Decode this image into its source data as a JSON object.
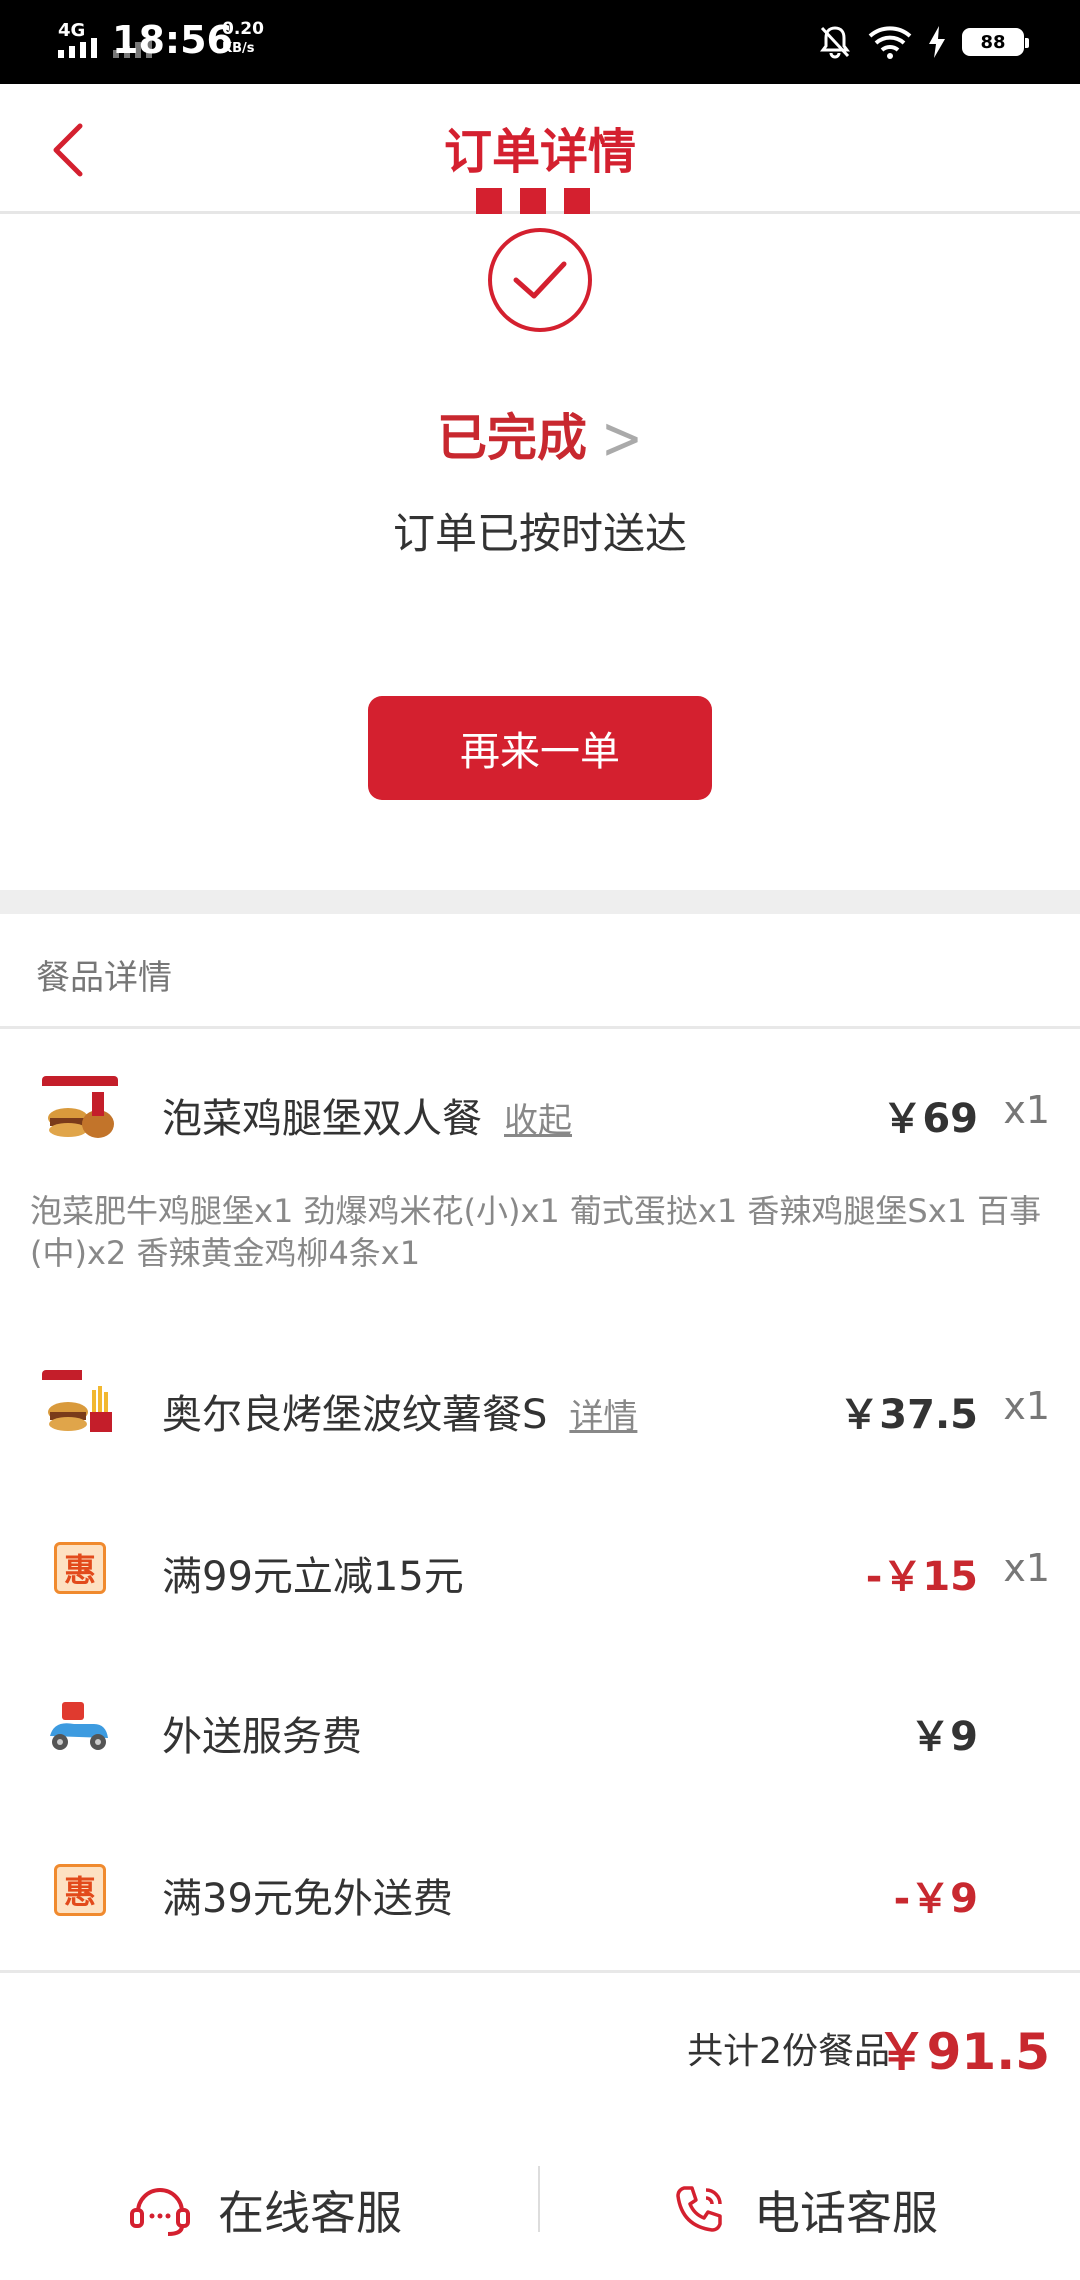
{
  "status_bar": {
    "network": "4G",
    "time": "18:56",
    "speed_value": "0.20",
    "speed_unit": "KB/s",
    "battery": "88"
  },
  "header": {
    "title": "订单详情"
  },
  "order_status": {
    "title": "已完成",
    "subtitle": "订单已按时送达",
    "reorder_label": "再来一单"
  },
  "items_section": {
    "title": "餐品详情",
    "items": [
      {
        "name": "泡菜鸡腿堡双人餐",
        "link": "收起",
        "price": "￥69",
        "qty": "x1",
        "description": "泡菜肥牛鸡腿堡x1 劲爆鸡米花(小)x1 葡式蛋挞x1 香辣鸡腿堡Sx1 百事(中)x2 香辣黄金鸡柳4条x1"
      },
      {
        "name": "奥尔良烤堡波纹薯餐S",
        "link": "详情",
        "price": "￥37.5",
        "qty": "x1"
      }
    ],
    "discount": {
      "badge": "惠",
      "name": "满99元立减15元",
      "price": "-￥15",
      "qty": "x1"
    },
    "delivery_fee": {
      "name": "外送服务费",
      "price": "￥9"
    },
    "delivery_discount": {
      "badge": "惠",
      "name": "满39元免外送费",
      "price": "-￥9"
    }
  },
  "total": {
    "label": "共计2份餐品",
    "value": "￥91.5"
  },
  "footer": {
    "online_service": "在线客服",
    "phone_service": "电话客服"
  },
  "colors": {
    "brand_red": "#d4202f",
    "price_red": "#c8282f",
    "badge_orange": "#f08a2e"
  }
}
